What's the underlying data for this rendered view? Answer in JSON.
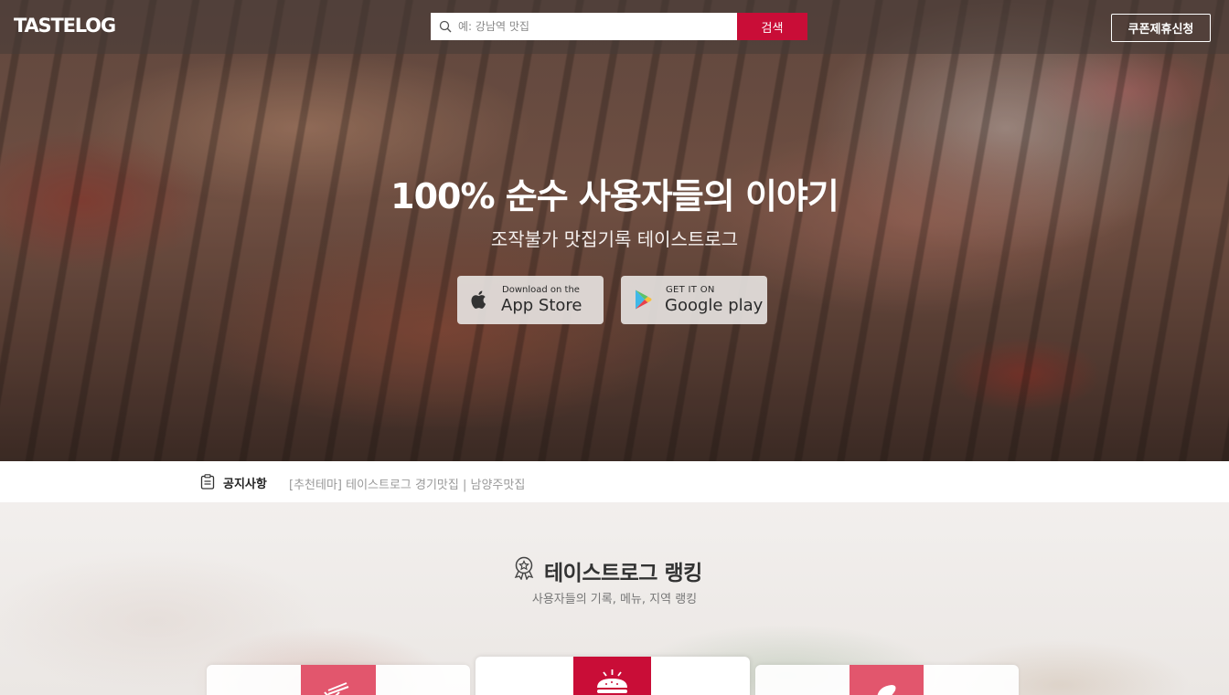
{
  "header": {
    "logo": "TASTELOG",
    "search_placeholder": "예: 강남역 맛집",
    "search_button": "검색",
    "coupon_button": "쿠폰제휴신청"
  },
  "hero": {
    "title": "100% 순수 사용자들의 이야기",
    "subtitle": "조작불가 맛집기록 테이스트로그",
    "app_store": {
      "small": "Download on the",
      "big": "App Store",
      "icon": "apple-icon"
    },
    "google_play": {
      "small": "GET IT ON",
      "big": "Google play",
      "icon": "google-play-icon"
    }
  },
  "notice": {
    "label": "공지사항",
    "text": "[추천테마] 테이스트로그 경기맛집 | 남양주맛집",
    "icon": "clipboard-icon"
  },
  "ranking": {
    "title": "테이스트로그 랭킹",
    "subtitle": "사용자들의 기록, 메뉴, 지역 랭킹",
    "icon": "award-icon",
    "cards": [
      {
        "icon": "noodle-icon"
      },
      {
        "icon": "burger-icon"
      },
      {
        "icon": "location-icon"
      }
    ]
  },
  "colors": {
    "accent": "#c90d37",
    "card_tile": "#e2566d"
  }
}
